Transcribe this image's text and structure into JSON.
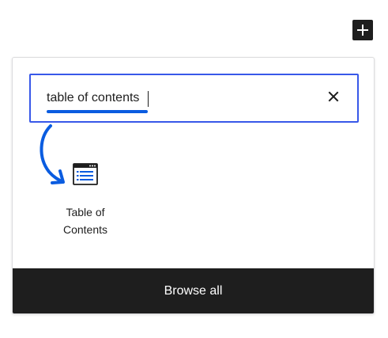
{
  "toolbar": {
    "add_block_icon": "plus-icon"
  },
  "search": {
    "value": "table of contents",
    "clear_icon": "close-icon"
  },
  "results": [
    {
      "label": "Table of\nContents",
      "icon": "table-of-contents-icon"
    }
  ],
  "annotation": {
    "arrow_icon": "curved-arrow-icon"
  },
  "footer": {
    "browse_all_label": "Browse all"
  },
  "colors": {
    "accent": "#3858e9",
    "annotation": "#0a5ce0",
    "dark": "#1e1e1e",
    "border": "#dcdcde"
  }
}
